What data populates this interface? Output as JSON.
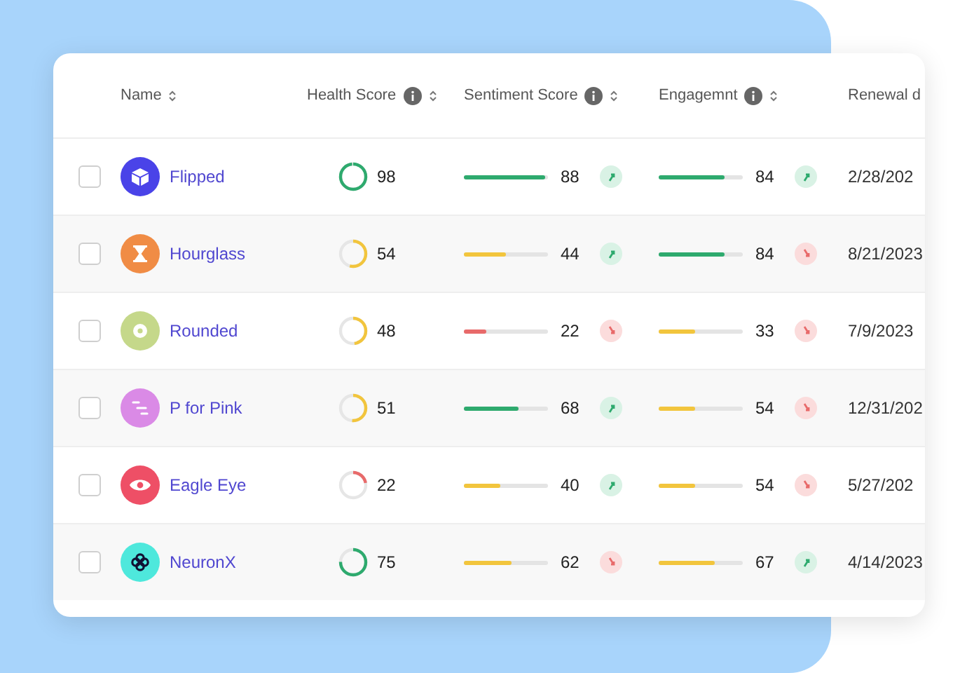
{
  "table": {
    "columns": [
      {
        "label": "Name",
        "info": false,
        "sortable": true
      },
      {
        "label": "Health Score",
        "info": true,
        "sortable": true
      },
      {
        "label": "Sentiment Score",
        "info": true,
        "sortable": true
      },
      {
        "label": "Engagemnt",
        "info": true,
        "sortable": true
      },
      {
        "label": "Renewal d",
        "info": false
      }
    ],
    "rows": [
      {
        "checked": false,
        "logo": {
          "kind": "cube",
          "color": "#4a43e8"
        },
        "name": "Flipped",
        "health": {
          "value": "98",
          "level": 0.98,
          "color": "#2eaa6e"
        },
        "sentiment": {
          "value": "88",
          "level": 0.96,
          "color": "#2eaa6e",
          "rising": true
        },
        "engagement": {
          "value": "84",
          "level": 0.78,
          "color": "#2eaa6e",
          "rising": true
        },
        "renewal": "2/28/202"
      },
      {
        "checked": false,
        "logo": {
          "kind": "hourglass",
          "color": "#f08c45"
        },
        "name": "Hourglass",
        "health": {
          "value": "54",
          "level": 0.54,
          "color": "#f2c53d"
        },
        "sentiment": {
          "value": "44",
          "level": 0.5,
          "color": "#f2c53d",
          "rising": true
        },
        "engagement": {
          "value": "84",
          "level": 0.78,
          "color": "#2eaa6e",
          "rising": false
        },
        "renewal": "8/21/2023"
      },
      {
        "checked": false,
        "logo": {
          "kind": "disc",
          "color": "#c5d88a"
        },
        "name": "Rounded",
        "health": {
          "value": "48",
          "level": 0.48,
          "color": "#f2c53d"
        },
        "sentiment": {
          "value": "22",
          "level": 0.27,
          "color": "#e86a6a",
          "rising": false
        },
        "engagement": {
          "value": "33",
          "level": 0.43,
          "color": "#f2c53d",
          "rising": false
        },
        "renewal": "7/9/2023"
      },
      {
        "checked": false,
        "logo": {
          "kind": "dashes",
          "color": "#da8ae6"
        },
        "name": "P for Pink",
        "health": {
          "value": "51",
          "level": 0.51,
          "color": "#f2c53d"
        },
        "sentiment": {
          "value": "68",
          "level": 0.65,
          "color": "#2eaa6e",
          "rising": true
        },
        "engagement": {
          "value": "54",
          "level": 0.43,
          "color": "#f2c53d",
          "rising": false
        },
        "renewal": "12/31/202"
      },
      {
        "checked": false,
        "logo": {
          "kind": "eye",
          "color": "#ee4f66"
        },
        "name": "Eagle Eye",
        "health": {
          "value": "22",
          "level": 0.22,
          "color": "#e86a6a"
        },
        "sentiment": {
          "value": "40",
          "level": 0.43,
          "color": "#f2c53d",
          "rising": true
        },
        "engagement": {
          "value": "54",
          "level": 0.43,
          "color": "#f2c53d",
          "rising": false
        },
        "renewal": "5/27/202"
      },
      {
        "checked": false,
        "logo": {
          "kind": "knot",
          "color": "#4ee8dc"
        },
        "name": "NeuronX",
        "health": {
          "value": "75",
          "level": 0.75,
          "color": "#2eaa6e"
        },
        "sentiment": {
          "value": "62",
          "level": 0.57,
          "color": "#f2c53d",
          "rising": false
        },
        "engagement": {
          "value": "67",
          "level": 0.67,
          "color": "#f2c53d",
          "rising": true
        },
        "renewal": "4/14/2023"
      }
    ]
  }
}
